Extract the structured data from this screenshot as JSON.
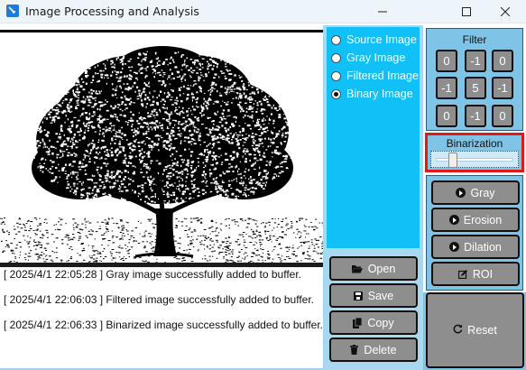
{
  "window": {
    "title": "Image Processing and Analysis",
    "minimize_icon": "minimize-icon",
    "maximize_icon": "maximize-icon",
    "close_icon": "close-icon"
  },
  "view_options": [
    {
      "label": "Source Image",
      "checked": false
    },
    {
      "label": "Gray Image",
      "checked": false
    },
    {
      "label": "Filtered Image",
      "checked": false
    },
    {
      "label": "Binary Image",
      "checked": true
    }
  ],
  "file_buttons": [
    {
      "label": "Open",
      "icon": "folder-open-icon"
    },
    {
      "label": "Save",
      "icon": "save-icon"
    },
    {
      "label": "Copy",
      "icon": "copy-icon"
    },
    {
      "label": "Delete",
      "icon": "trash-icon"
    }
  ],
  "filter": {
    "title": "Filter",
    "kernel": [
      [
        "0",
        "-1",
        "0"
      ],
      [
        "-1",
        "5",
        "-1"
      ],
      [
        "0",
        "-1",
        "0"
      ]
    ]
  },
  "binarization": {
    "title": "Binarization",
    "slider_value": 0.22
  },
  "operations": [
    {
      "label": "Gray",
      "icon": "play-circle-icon"
    },
    {
      "label": "Erosion",
      "icon": "play-circle-icon"
    },
    {
      "label": "Dilation",
      "icon": "play-circle-icon"
    },
    {
      "label": "ROI",
      "icon": "edit-icon"
    }
  ],
  "reset": {
    "label": "Reset",
    "icon": "refresh-icon"
  },
  "log": [
    "[ 2025/4/1 22:05:28 ] Gray image successfully added to buffer.",
    "[ 2025/4/1 22:06:03 ] Filtered image successfully added to buffer.",
    "[ 2025/4/1 22:06:33 ] Binarized image successfully added to buffer."
  ],
  "colors": {
    "radio_panel_bg": "#12c0f8",
    "panel_bg": "#7fc3e6",
    "button_bg": "#8e8e8e",
    "highlight_border": "#e01818"
  }
}
